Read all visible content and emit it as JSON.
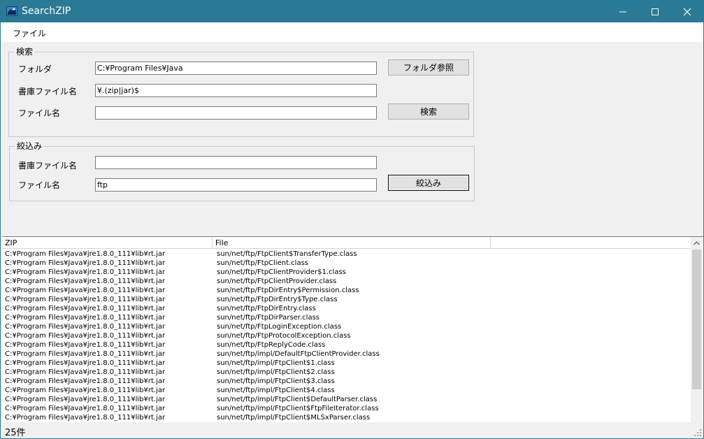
{
  "window": {
    "title": "SearchZIP",
    "accent_color": "#2b7a95"
  },
  "menu": {
    "items": [
      {
        "label": "ファイル"
      }
    ]
  },
  "search_group": {
    "label": "検索",
    "folder_label": "フォルダ",
    "folder_value": "C:¥Program Files¥Java",
    "archive_label": "書庫ファイル名",
    "archive_value": "¥.(zip|jar)$",
    "file_label": "ファイル名",
    "file_value": "",
    "browse_button": "フォルダ参照",
    "search_button": "検索"
  },
  "filter_group": {
    "label": "絞込み",
    "archive_label": "書庫ファイル名",
    "archive_value": "",
    "file_label": "ファイル名",
    "file_value": "ftp",
    "filter_button": "絞込み"
  },
  "results": {
    "columns": [
      "ZIP",
      "File"
    ],
    "rows": [
      {
        "zip": "C:¥Program Files¥Java¥jre1.8.0_111¥lib¥rt.jar",
        "file": "sun/net/ftp/FtpClient$TransferType.class"
      },
      {
        "zip": "C:¥Program Files¥Java¥jre1.8.0_111¥lib¥rt.jar",
        "file": "sun/net/ftp/FtpClient.class"
      },
      {
        "zip": "C:¥Program Files¥Java¥jre1.8.0_111¥lib¥rt.jar",
        "file": "sun/net/ftp/FtpClientProvider$1.class"
      },
      {
        "zip": "C:¥Program Files¥Java¥jre1.8.0_111¥lib¥rt.jar",
        "file": "sun/net/ftp/FtpClientProvider.class"
      },
      {
        "zip": "C:¥Program Files¥Java¥jre1.8.0_111¥lib¥rt.jar",
        "file": "sun/net/ftp/FtpDirEntry$Permission.class"
      },
      {
        "zip": "C:¥Program Files¥Java¥jre1.8.0_111¥lib¥rt.jar",
        "file": "sun/net/ftp/FtpDirEntry$Type.class"
      },
      {
        "zip": "C:¥Program Files¥Java¥jre1.8.0_111¥lib¥rt.jar",
        "file": "sun/net/ftp/FtpDirEntry.class"
      },
      {
        "zip": "C:¥Program Files¥Java¥jre1.8.0_111¥lib¥rt.jar",
        "file": "sun/net/ftp/FtpDirParser.class"
      },
      {
        "zip": "C:¥Program Files¥Java¥jre1.8.0_111¥lib¥rt.jar",
        "file": "sun/net/ftp/FtpLoginException.class"
      },
      {
        "zip": "C:¥Program Files¥Java¥jre1.8.0_111¥lib¥rt.jar",
        "file": "sun/net/ftp/FtpProtocolException.class"
      },
      {
        "zip": "C:¥Program Files¥Java¥jre1.8.0_111¥lib¥rt.jar",
        "file": "sun/net/ftp/FtpReplyCode.class"
      },
      {
        "zip": "C:¥Program Files¥Java¥jre1.8.0_111¥lib¥rt.jar",
        "file": "sun/net/ftp/impl/DefaultFtpClientProvider.class"
      },
      {
        "zip": "C:¥Program Files¥Java¥jre1.8.0_111¥lib¥rt.jar",
        "file": "sun/net/ftp/impl/FtpClient$1.class"
      },
      {
        "zip": "C:¥Program Files¥Java¥jre1.8.0_111¥lib¥rt.jar",
        "file": "sun/net/ftp/impl/FtpClient$2.class"
      },
      {
        "zip": "C:¥Program Files¥Java¥jre1.8.0_111¥lib¥rt.jar",
        "file": "sun/net/ftp/impl/FtpClient$3.class"
      },
      {
        "zip": "C:¥Program Files¥Java¥jre1.8.0_111¥lib¥rt.jar",
        "file": "sun/net/ftp/impl/FtpClient$4.class"
      },
      {
        "zip": "C:¥Program Files¥Java¥jre1.8.0_111¥lib¥rt.jar",
        "file": "sun/net/ftp/impl/FtpClient$DefaultParser.class"
      },
      {
        "zip": "C:¥Program Files¥Java¥jre1.8.0_111¥lib¥rt.jar",
        "file": "sun/net/ftp/impl/FtpClient$FtpFileIterator.class"
      },
      {
        "zip": "C:¥Program Files¥Java¥jre1.8.0_111¥lib¥rt.jar",
        "file": "sun/net/ftp/impl/FtpClient$MLSxParser.class"
      }
    ]
  },
  "status": {
    "text": "25件"
  }
}
